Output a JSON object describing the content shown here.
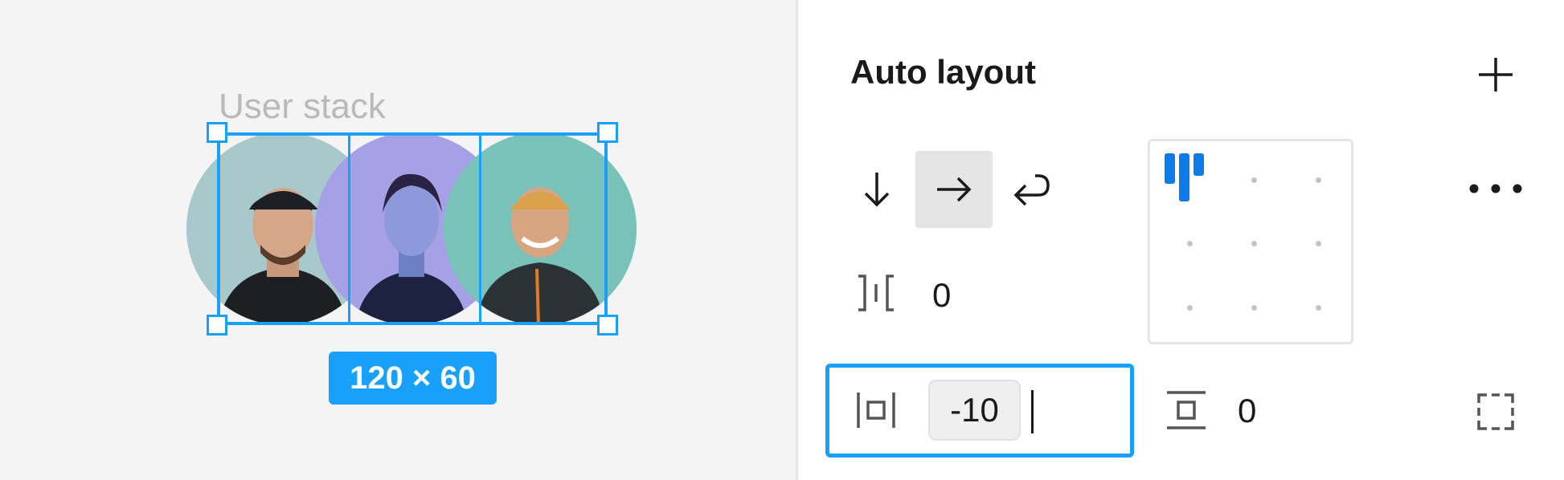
{
  "canvas": {
    "frame_label": "User stack",
    "size_badge": "120 × 60",
    "avatars": [
      "avatar-man-cap",
      "avatar-woman",
      "avatar-man-smiling"
    ]
  },
  "panel": {
    "title": "Auto layout",
    "add_icon": "plus-icon",
    "direction": {
      "options": [
        "vertical",
        "horizontal",
        "wrap"
      ],
      "selected": "horizontal"
    },
    "spacing_value": "0",
    "alignment": {
      "selected": "top-left"
    },
    "more_icon": "ellipsis-icon",
    "horizontal_padding_value": "-10",
    "vertical_padding_value": "0",
    "individual_padding_icon": "dashed-box-icon"
  },
  "colors": {
    "selection": "#18a0fb",
    "accent": "#0d7ce8"
  }
}
